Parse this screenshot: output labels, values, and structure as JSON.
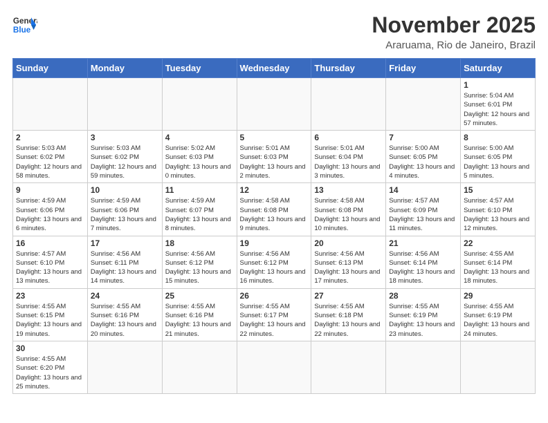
{
  "logo": {
    "line1": "General",
    "line2": "Blue"
  },
  "header": {
    "month": "November 2025",
    "location": "Araruama, Rio de Janeiro, Brazil"
  },
  "weekdays": [
    "Sunday",
    "Monday",
    "Tuesday",
    "Wednesday",
    "Thursday",
    "Friday",
    "Saturday"
  ],
  "weeks": [
    [
      {
        "day": "",
        "info": ""
      },
      {
        "day": "",
        "info": ""
      },
      {
        "day": "",
        "info": ""
      },
      {
        "day": "",
        "info": ""
      },
      {
        "day": "",
        "info": ""
      },
      {
        "day": "",
        "info": ""
      },
      {
        "day": "1",
        "info": "Sunrise: 5:04 AM\nSunset: 6:01 PM\nDaylight: 12 hours and 57 minutes."
      }
    ],
    [
      {
        "day": "2",
        "info": "Sunrise: 5:03 AM\nSunset: 6:02 PM\nDaylight: 12 hours and 58 minutes."
      },
      {
        "day": "3",
        "info": "Sunrise: 5:03 AM\nSunset: 6:02 PM\nDaylight: 12 hours and 59 minutes."
      },
      {
        "day": "4",
        "info": "Sunrise: 5:02 AM\nSunset: 6:03 PM\nDaylight: 13 hours and 0 minutes."
      },
      {
        "day": "5",
        "info": "Sunrise: 5:01 AM\nSunset: 6:03 PM\nDaylight: 13 hours and 2 minutes."
      },
      {
        "day": "6",
        "info": "Sunrise: 5:01 AM\nSunset: 6:04 PM\nDaylight: 13 hours and 3 minutes."
      },
      {
        "day": "7",
        "info": "Sunrise: 5:00 AM\nSunset: 6:05 PM\nDaylight: 13 hours and 4 minutes."
      },
      {
        "day": "8",
        "info": "Sunrise: 5:00 AM\nSunset: 6:05 PM\nDaylight: 13 hours and 5 minutes."
      }
    ],
    [
      {
        "day": "9",
        "info": "Sunrise: 4:59 AM\nSunset: 6:06 PM\nDaylight: 13 hours and 6 minutes."
      },
      {
        "day": "10",
        "info": "Sunrise: 4:59 AM\nSunset: 6:06 PM\nDaylight: 13 hours and 7 minutes."
      },
      {
        "day": "11",
        "info": "Sunrise: 4:59 AM\nSunset: 6:07 PM\nDaylight: 13 hours and 8 minutes."
      },
      {
        "day": "12",
        "info": "Sunrise: 4:58 AM\nSunset: 6:08 PM\nDaylight: 13 hours and 9 minutes."
      },
      {
        "day": "13",
        "info": "Sunrise: 4:58 AM\nSunset: 6:08 PM\nDaylight: 13 hours and 10 minutes."
      },
      {
        "day": "14",
        "info": "Sunrise: 4:57 AM\nSunset: 6:09 PM\nDaylight: 13 hours and 11 minutes."
      },
      {
        "day": "15",
        "info": "Sunrise: 4:57 AM\nSunset: 6:10 PM\nDaylight: 13 hours and 12 minutes."
      }
    ],
    [
      {
        "day": "16",
        "info": "Sunrise: 4:57 AM\nSunset: 6:10 PM\nDaylight: 13 hours and 13 minutes."
      },
      {
        "day": "17",
        "info": "Sunrise: 4:56 AM\nSunset: 6:11 PM\nDaylight: 13 hours and 14 minutes."
      },
      {
        "day": "18",
        "info": "Sunrise: 4:56 AM\nSunset: 6:12 PM\nDaylight: 13 hours and 15 minutes."
      },
      {
        "day": "19",
        "info": "Sunrise: 4:56 AM\nSunset: 6:12 PM\nDaylight: 13 hours and 16 minutes."
      },
      {
        "day": "20",
        "info": "Sunrise: 4:56 AM\nSunset: 6:13 PM\nDaylight: 13 hours and 17 minutes."
      },
      {
        "day": "21",
        "info": "Sunrise: 4:56 AM\nSunset: 6:14 PM\nDaylight: 13 hours and 18 minutes."
      },
      {
        "day": "22",
        "info": "Sunrise: 4:55 AM\nSunset: 6:14 PM\nDaylight: 13 hours and 18 minutes."
      }
    ],
    [
      {
        "day": "23",
        "info": "Sunrise: 4:55 AM\nSunset: 6:15 PM\nDaylight: 13 hours and 19 minutes."
      },
      {
        "day": "24",
        "info": "Sunrise: 4:55 AM\nSunset: 6:16 PM\nDaylight: 13 hours and 20 minutes."
      },
      {
        "day": "25",
        "info": "Sunrise: 4:55 AM\nSunset: 6:16 PM\nDaylight: 13 hours and 21 minutes."
      },
      {
        "day": "26",
        "info": "Sunrise: 4:55 AM\nSunset: 6:17 PM\nDaylight: 13 hours and 22 minutes."
      },
      {
        "day": "27",
        "info": "Sunrise: 4:55 AM\nSunset: 6:18 PM\nDaylight: 13 hours and 22 minutes."
      },
      {
        "day": "28",
        "info": "Sunrise: 4:55 AM\nSunset: 6:19 PM\nDaylight: 13 hours and 23 minutes."
      },
      {
        "day": "29",
        "info": "Sunrise: 4:55 AM\nSunset: 6:19 PM\nDaylight: 13 hours and 24 minutes."
      }
    ],
    [
      {
        "day": "30",
        "info": "Sunrise: 4:55 AM\nSunset: 6:20 PM\nDaylight: 13 hours and 25 minutes."
      },
      {
        "day": "",
        "info": ""
      },
      {
        "day": "",
        "info": ""
      },
      {
        "day": "",
        "info": ""
      },
      {
        "day": "",
        "info": ""
      },
      {
        "day": "",
        "info": ""
      },
      {
        "day": "",
        "info": ""
      }
    ]
  ]
}
